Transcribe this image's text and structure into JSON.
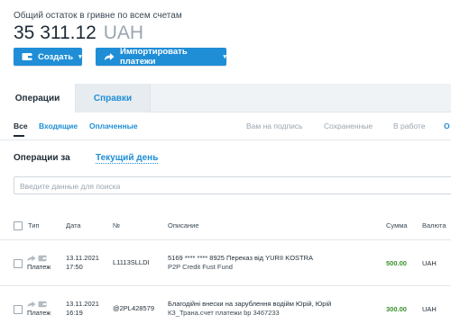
{
  "header": {
    "balance_label": "Общий остаток в гривне по всем счетам",
    "balance_amount": "35 311.12",
    "balance_currency": "UAH"
  },
  "toolbar": {
    "create_label": "Создать",
    "import_label": "Импортировать платежи"
  },
  "tabs": [
    {
      "label": "Операции",
      "active": true
    },
    {
      "label": "Справки",
      "active": false
    }
  ],
  "filters": {
    "all": "Все",
    "incoming": "Входящие",
    "paid": "Оплаченные",
    "to_sign": "Вам на подпись",
    "saved": "Сохраненные",
    "in_progress": "В работе",
    "more": "О"
  },
  "period": {
    "label": "Операции за",
    "value": "Текущий день"
  },
  "search": {
    "placeholder": "Введите данные для поиска"
  },
  "table": {
    "headers": {
      "type": "Тип",
      "date": "Дата",
      "number": "№",
      "description": "Описание",
      "sum": "Сумма",
      "currency": "Валюта"
    },
    "rows": [
      {
        "type": "Платеж",
        "date": "13.11.2021",
        "time": "17:50",
        "number": "L1113SLLDI",
        "description": "5169 **** **** 8925 Переказ від YURII KOSTRA",
        "description_sub": "P2P Credit Fust Fund",
        "sum": "500.00",
        "currency": "UAH"
      },
      {
        "type": "Платеж",
        "date": "13.11.2021",
        "time": "16:19",
        "number": "@2PL428579",
        "description": "Благодійні внески на зарублення водійм Юрій, Юрій",
        "description_sub": "КЗ_Трана.счет платежи bp 3467233",
        "sum": "300.00",
        "currency": "UAH"
      }
    ]
  },
  "colors": {
    "accent": "#1f8ed6",
    "positive": "#3a8f2c",
    "muted": "#9aa6b0"
  }
}
